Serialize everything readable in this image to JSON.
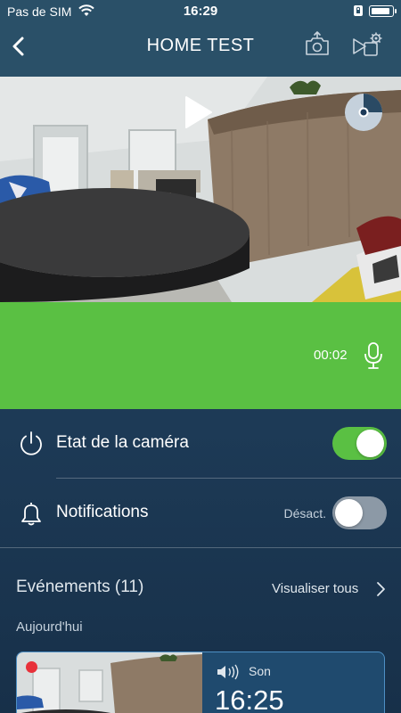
{
  "status_bar": {
    "carrier": "Pas de SIM",
    "time": "16:29",
    "battery_level": 0.9
  },
  "nav": {
    "title": "HOME TEST",
    "back_icon": "chevron-left-icon",
    "snapshot_icon": "camera-upload-icon",
    "video_settings_icon": "video-gear-icon"
  },
  "camera_feed": {
    "play_icon": "play-icon",
    "view_dial_icon": "view-dial-icon"
  },
  "talk": {
    "timer": "00:02",
    "mic_icon": "microphone-icon",
    "color": "#5ac043"
  },
  "settings": {
    "camera_state": {
      "label": "Etat de la caméra",
      "enabled": true,
      "icon": "power-icon"
    },
    "notifications": {
      "label": "Notifications",
      "status": "Désact.",
      "enabled": false,
      "icon": "bell-icon"
    }
  },
  "events": {
    "heading": "Evénements (11)",
    "view_all": "Visualiser tous",
    "day_label": "Aujourd'hui",
    "items": [
      {
        "type": "Son",
        "time": "16:25",
        "icon": "speaker-icon",
        "recording": true
      }
    ]
  },
  "colors": {
    "accent_green": "#5ac043",
    "header_blue": "#2a5068",
    "card_border": "#4d8fc4",
    "record_red": "#e8313a"
  }
}
